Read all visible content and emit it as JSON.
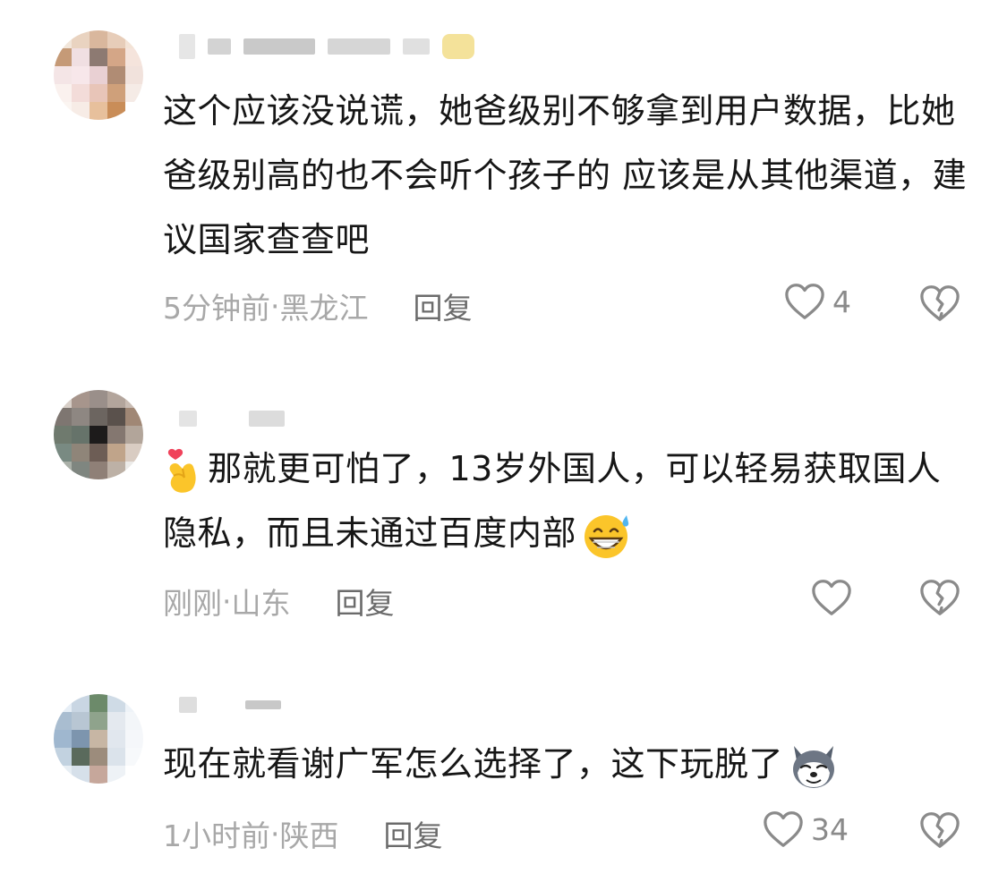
{
  "comments": [
    {
      "username_blurred": "██ ██████",
      "text": "这个应该没说谎，她爸级别不够拿到用户数据，比她爸级别高的也不会听个孩子的 应该是从其他渠道，建议国家查查吧",
      "time": "5分钟前",
      "location": "黑龙江",
      "reply_label": "回复",
      "likes": "4"
    },
    {
      "text": "那就更可怕了，13岁外国人，可以轻易获取国人隐私，而且未通过百度内部",
      "time": "刚刚",
      "location": "山东",
      "reply_label": "回复",
      "likes": ""
    },
    {
      "text": "现在就看谢广军怎么选择了，这下玩脱了",
      "time": "1小时前",
      "location": "陕西",
      "reply_label": "回复",
      "likes": "34"
    }
  ],
  "separator": " · ",
  "icons": {
    "like": "heart-outline-icon",
    "dislike": "broken-heart-icon",
    "emoji_finger_heart": "finger-heart-emoji",
    "emoji_grin_sweat": "grinning-sweat-emoji",
    "emoji_husky": "husky-dog-emoji"
  },
  "colors": {
    "text": "#161616",
    "meta": "#a8a8a8",
    "reply": "#6b6b6b",
    "icon": "#8a8a8a"
  }
}
